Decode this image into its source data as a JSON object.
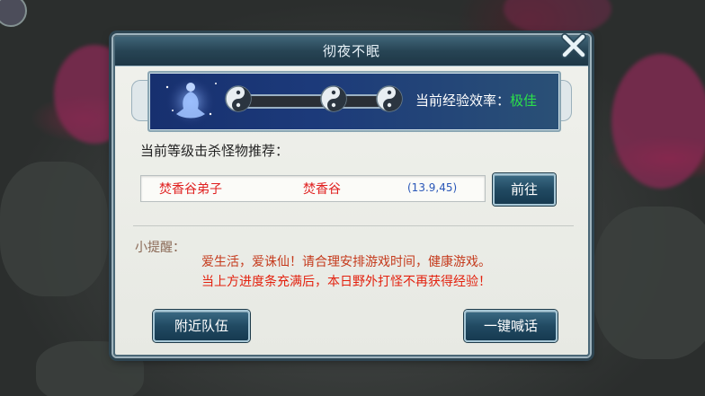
{
  "dialog": {
    "title": "彻夜不眠",
    "efficiency_label": "当前经验效率：",
    "efficiency_value": "极佳",
    "progress_fraction": 1.0,
    "recommend_title": "当前等级击杀怪物推荐：",
    "recommendation": {
      "monster": "焚香谷弟子",
      "map": "焚香谷",
      "coords": "(13.9,45)"
    },
    "goto_label": "前往",
    "tip_label": "小提醒：",
    "tip_line1": "爱生活，爱诛仙！请合理安排游戏时间，健康游戏。",
    "tip_line2": "当上方进度条充满后，本日野外打怪不再获得经验！",
    "nearby_team_label": "附近队伍",
    "one_click_shout_label": "一键喊话"
  },
  "colors": {
    "efficiency_value": "#2be04a",
    "recommendation_text": "#e02020",
    "coords_text": "#2a57b8",
    "warning_text": "#e3220f",
    "title_bar": "#274454"
  },
  "icons": [
    "meditating-figure-icon",
    "yin-yang-icon",
    "close-x-icon"
  ]
}
